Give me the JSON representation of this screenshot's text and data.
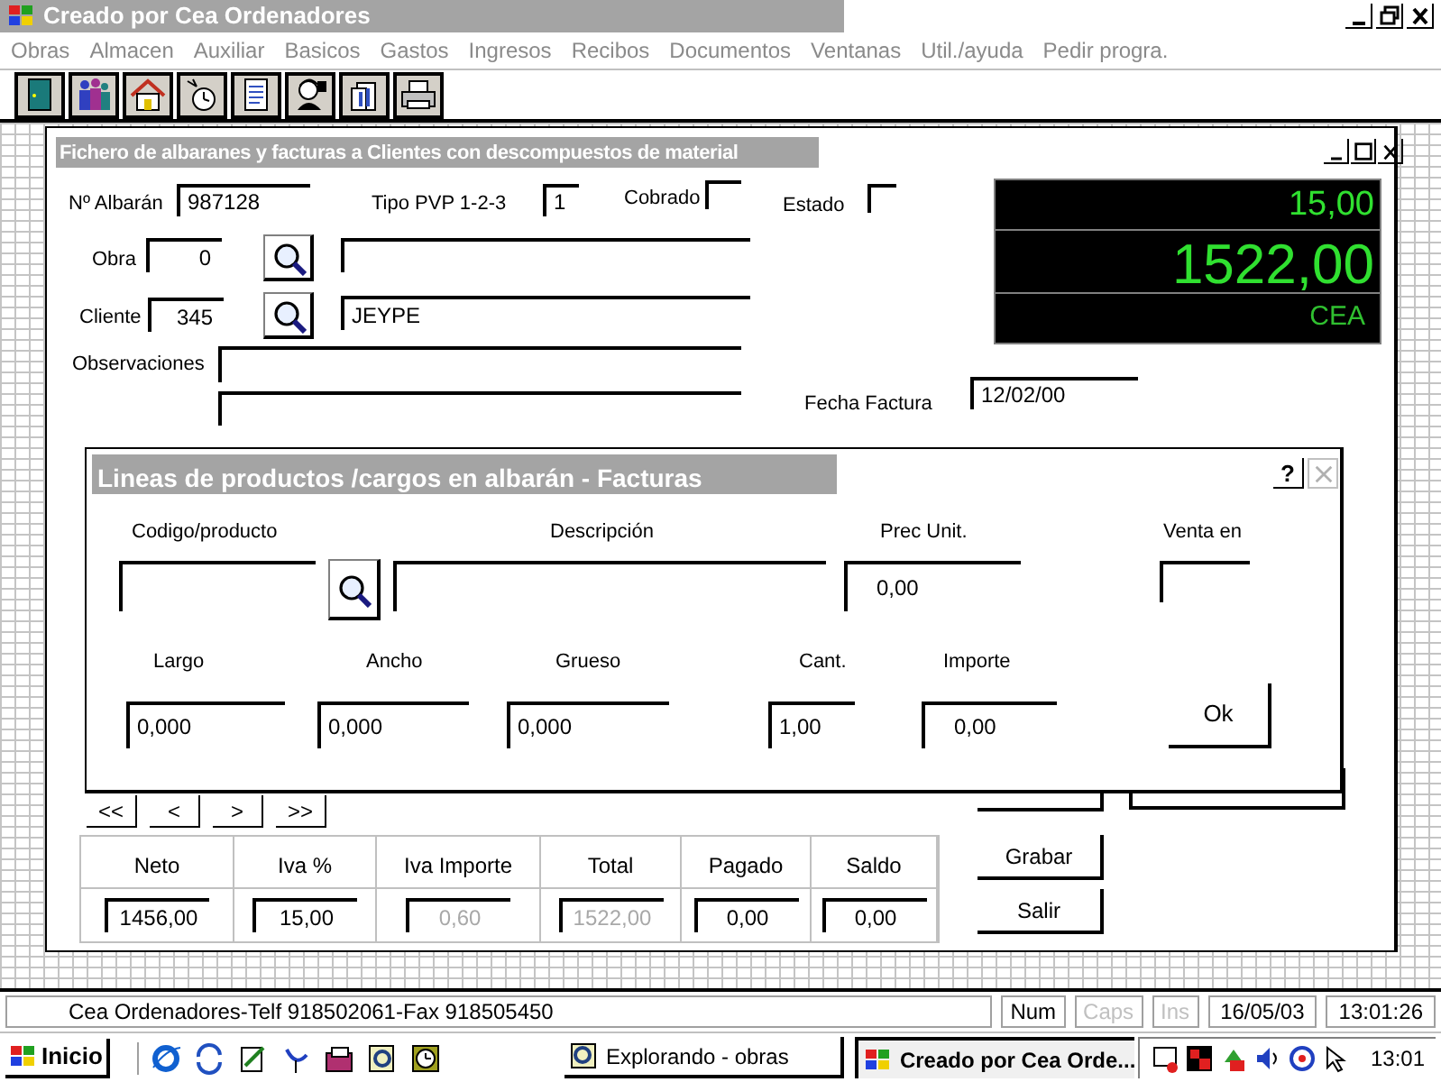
{
  "window": {
    "title": "Creado por Cea Ordenadores"
  },
  "menu": [
    "Obras",
    "Almacen",
    "Auxiliar",
    "Basicos",
    "Gastos",
    "Ingresos",
    "Recibos",
    "Documentos",
    "Ventanas",
    "Util./ayuda",
    "Pedir progra."
  ],
  "form": {
    "title": "Fichero de albaranes y facturas a Clientes con descompuestos de material",
    "n_albaran": {
      "label": "Nº Albarán",
      "value": "987128"
    },
    "tipo_pvp": {
      "label": "Tipo PVP 1-2-3",
      "value": "1"
    },
    "cobrado": {
      "label": "Cobrado"
    },
    "estado": {
      "label": "Estado"
    },
    "obra": {
      "label": "Obra",
      "value": "0"
    },
    "cliente": {
      "label": "Cliente",
      "value": "345",
      "name": "JEYPE"
    },
    "observaciones": {
      "label": "Observaciones"
    },
    "fecha_factura": {
      "label": "Fecha Factura",
      "value": "12/02/00"
    },
    "display": {
      "line_1": "15,00",
      "line_2": "1522,00",
      "line_3": "CEA"
    },
    "nav_buttons": [
      "<<",
      "<",
      ">",
      ">>"
    ],
    "totals": [
      {
        "label": "Neto",
        "value": "1456,00",
        "disabled": false
      },
      {
        "label": "Iva %",
        "value": "15,00",
        "disabled": false
      },
      {
        "label": "Iva Importe",
        "value": "0,60",
        "disabled": true
      },
      {
        "label": "Total",
        "value": "1522,00",
        "disabled": true
      },
      {
        "label": "Pagado",
        "value": "0,00",
        "disabled": false
      },
      {
        "label": "Saldo",
        "value": "0,00",
        "disabled": false
      }
    ],
    "buttons": [
      "Grabar",
      "Salir"
    ]
  },
  "dialog": {
    "title": "Lineas de productos /cargos en albarán - Facturas",
    "help_button": "?",
    "codigo": {
      "label": "Codigo/producto"
    },
    "descripcion": {
      "label": "Descripción"
    },
    "prec_unit": {
      "label": "Prec Unit.",
      "value": "0,00"
    },
    "venta_en": {
      "label": "Venta en"
    },
    "largo": {
      "label": "Largo",
      "value": "0,000"
    },
    "ancho": {
      "label": "Ancho",
      "value": "0,000"
    },
    "grueso": {
      "label": "Grueso",
      "value": "0,000"
    },
    "cant": {
      "label": "Cant.",
      "value": "1,00"
    },
    "importe": {
      "label": "Importe",
      "value": "0,00"
    },
    "ok_button": "Ok"
  },
  "status_bar": {
    "text": "Cea Ordenadores-Telf 918502061-Fax 918505450",
    "indicators": [
      {
        "label": "Num",
        "enabled": true
      },
      {
        "label": "Caps",
        "enabled": false
      },
      {
        "label": "Ins",
        "enabled": false
      }
    ],
    "date": "16/05/03",
    "time": "13:01:26"
  },
  "taskbar": {
    "start": "Inicio",
    "tasks": [
      {
        "label": "Explorando - obras",
        "selected": false
      },
      {
        "label": "Creado por Cea Orde...",
        "selected": true
      }
    ],
    "clock": "13:01"
  }
}
